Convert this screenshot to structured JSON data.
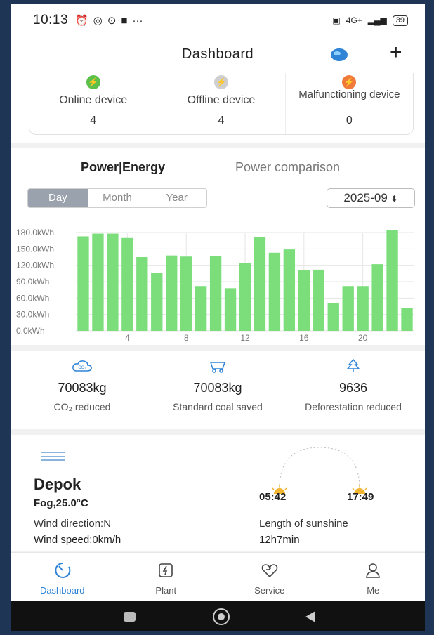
{
  "status_bar": {
    "time": "10:13",
    "network": "4G+",
    "battery": "39"
  },
  "header": {
    "title": "Dashboard",
    "add_label": "+"
  },
  "devices": [
    {
      "label": "Online device",
      "count": "4",
      "icon": "bolt-icon",
      "color": "#5cc04a"
    },
    {
      "label": "Offline device",
      "count": "4",
      "icon": "bolt-icon",
      "color": "#cfcfcf"
    },
    {
      "label": "Malfunctioning device",
      "count": "0",
      "icon": "bolt-icon",
      "color": "#ef7a3a"
    }
  ],
  "energy": {
    "tabs": [
      "Power|Energy",
      "Power comparison"
    ],
    "periods": [
      "Day",
      "Month",
      "Year"
    ],
    "selected_period": "Day",
    "date": "2025-09"
  },
  "chart_data": {
    "type": "bar",
    "x": [
      1,
      2,
      3,
      4,
      5,
      6,
      7,
      8,
      9,
      10,
      11,
      12,
      13,
      14,
      15,
      16,
      17,
      18,
      19,
      20,
      21,
      22,
      23
    ],
    "values": [
      173,
      178,
      178,
      170,
      135,
      106,
      138,
      136,
      82,
      137,
      78,
      124,
      171,
      143,
      149,
      111,
      112,
      51,
      82,
      82,
      122,
      184,
      42
    ],
    "ylabel": "kWh",
    "ylim": [
      0,
      180
    ],
    "yticks": [
      "0.0kWh",
      "30.0kWh",
      "60.0kWh",
      "90.0kWh",
      "120.0kWh",
      "150.0kWh",
      "180.0kWh"
    ],
    "xticks": [
      4,
      8,
      12,
      16,
      20
    ],
    "color": "#7bde7b",
    "grid": true
  },
  "environment": [
    {
      "value": "70083kg",
      "label": "CO₂ reduced",
      "icon": "co2-cloud-icon"
    },
    {
      "value": "70083kg",
      "label": "Standard coal saved",
      "icon": "coal-cart-icon"
    },
    {
      "value": "9636",
      "label": "Deforestation reduced",
      "icon": "tree-icon"
    }
  ],
  "weather": {
    "city": "Depok",
    "condition": "Fog,25.0°C",
    "wind_direction": "Wind direction:N",
    "wind_speed": "Wind speed:0km/h",
    "sunrise": "05:42",
    "sunset": "17:49",
    "sunshine_label": "Length of sunshine",
    "sunshine_value": "12h7min"
  },
  "nav": [
    {
      "label": "Dashboard",
      "icon": "dashboard-icon",
      "active": true
    },
    {
      "label": "Plant",
      "icon": "plant-icon",
      "active": false
    },
    {
      "label": "Service",
      "icon": "service-icon",
      "active": false
    },
    {
      "label": "Me",
      "icon": "me-icon",
      "active": false
    }
  ],
  "colors": {
    "accent": "#2f84d6",
    "bar": "#7bde7b"
  }
}
